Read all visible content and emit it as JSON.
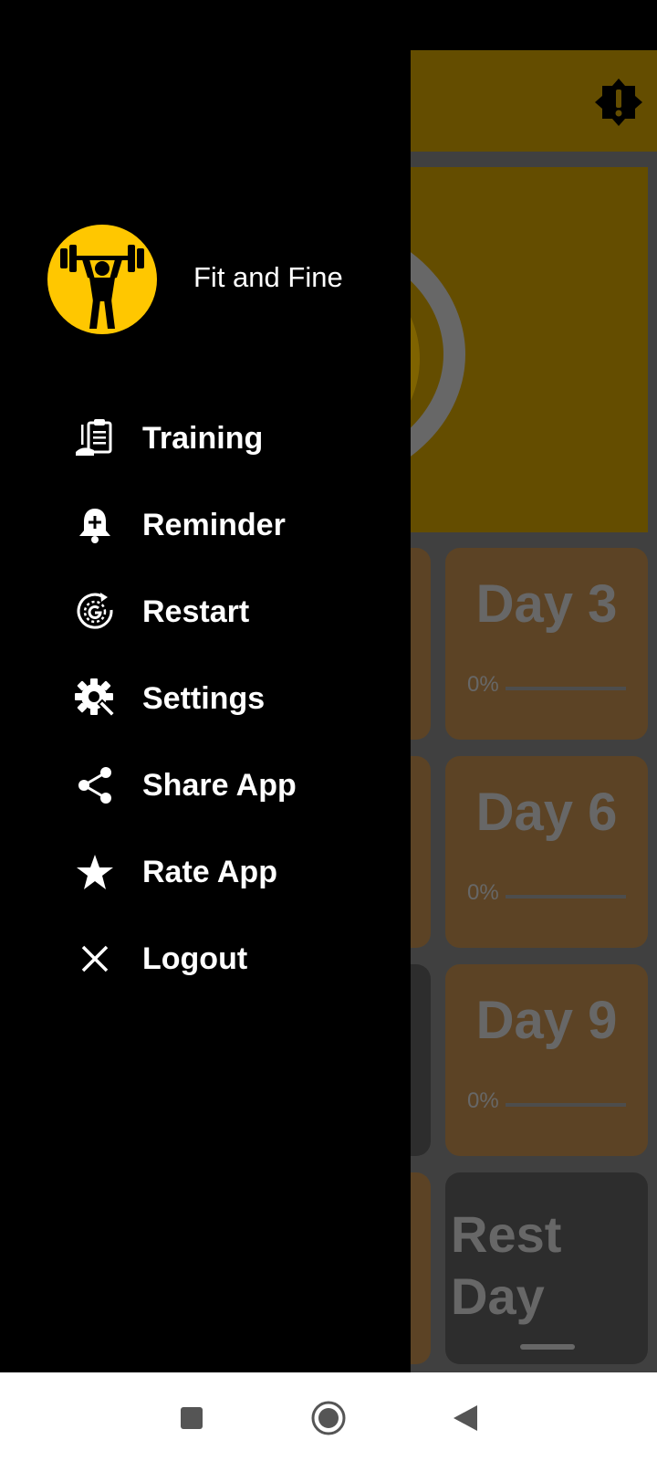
{
  "app": {
    "cards": [
      {
        "title": "Day 3",
        "progress_label": "0%",
        "progress": 0
      },
      {
        "title": "Day 6",
        "progress_label": "0%",
        "progress": 0
      },
      {
        "title": "Day 9",
        "progress_label": "0%",
        "progress": 0
      }
    ],
    "rest_card": {
      "line1": "Rest",
      "line2": "Day"
    },
    "icons": {
      "toolbar": "alert-badge-icon"
    },
    "colors": {
      "accent": "#ffc700",
      "toolbar": "#c89a00",
      "card": "#b8874a"
    }
  },
  "drawer": {
    "title": "Fit and Fine",
    "logo_icon": "weightlifter-icon",
    "menu": [
      {
        "label": "Training",
        "icon": "training-plan-icon"
      },
      {
        "label": "Reminder",
        "icon": "bell-add-icon"
      },
      {
        "label": "Restart",
        "icon": "restart-target-icon"
      },
      {
        "label": "Settings",
        "icon": "gear-wrench-icon"
      },
      {
        "label": "Share App",
        "icon": "share-icon"
      },
      {
        "label": "Rate App",
        "icon": "star-icon"
      },
      {
        "label": "Logout",
        "icon": "close-icon"
      }
    ]
  },
  "system_nav": {
    "buttons": [
      "recents-icon",
      "home-icon",
      "back-icon"
    ]
  }
}
